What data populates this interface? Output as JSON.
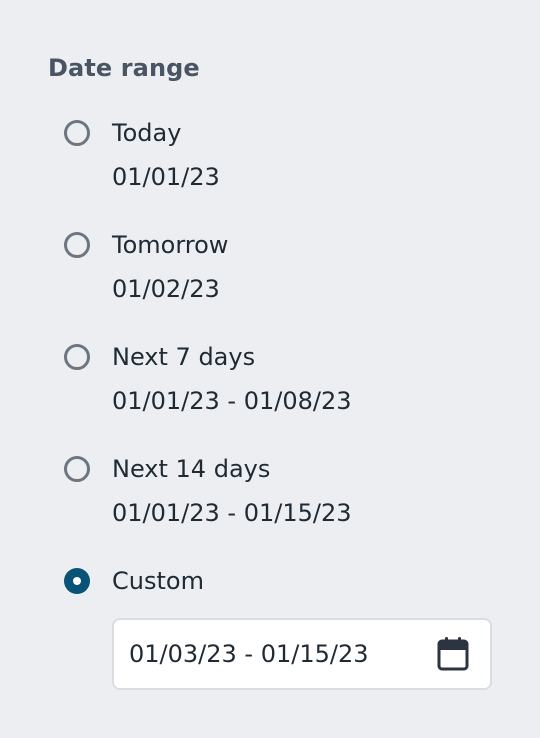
{
  "heading": "Date range",
  "options": [
    {
      "label": "Today",
      "range": "01/01/23",
      "selected": false
    },
    {
      "label": "Tomorrow",
      "range": "01/02/23",
      "selected": false
    },
    {
      "label": "Next 7 days",
      "range": "01/01/23 - 01/08/23",
      "selected": false
    },
    {
      "label": "Next 14 days",
      "range": "01/01/23 - 01/15/23",
      "selected": false
    },
    {
      "label": "Custom",
      "selected": true
    }
  ],
  "custom_input": {
    "value": "01/03/23 - 01/15/23",
    "icon": "calendar-icon"
  },
  "colors": {
    "background": "#eceef1",
    "selected_radio": "#0a5378",
    "heading": "#4a5563",
    "text": "#1f2a35"
  }
}
